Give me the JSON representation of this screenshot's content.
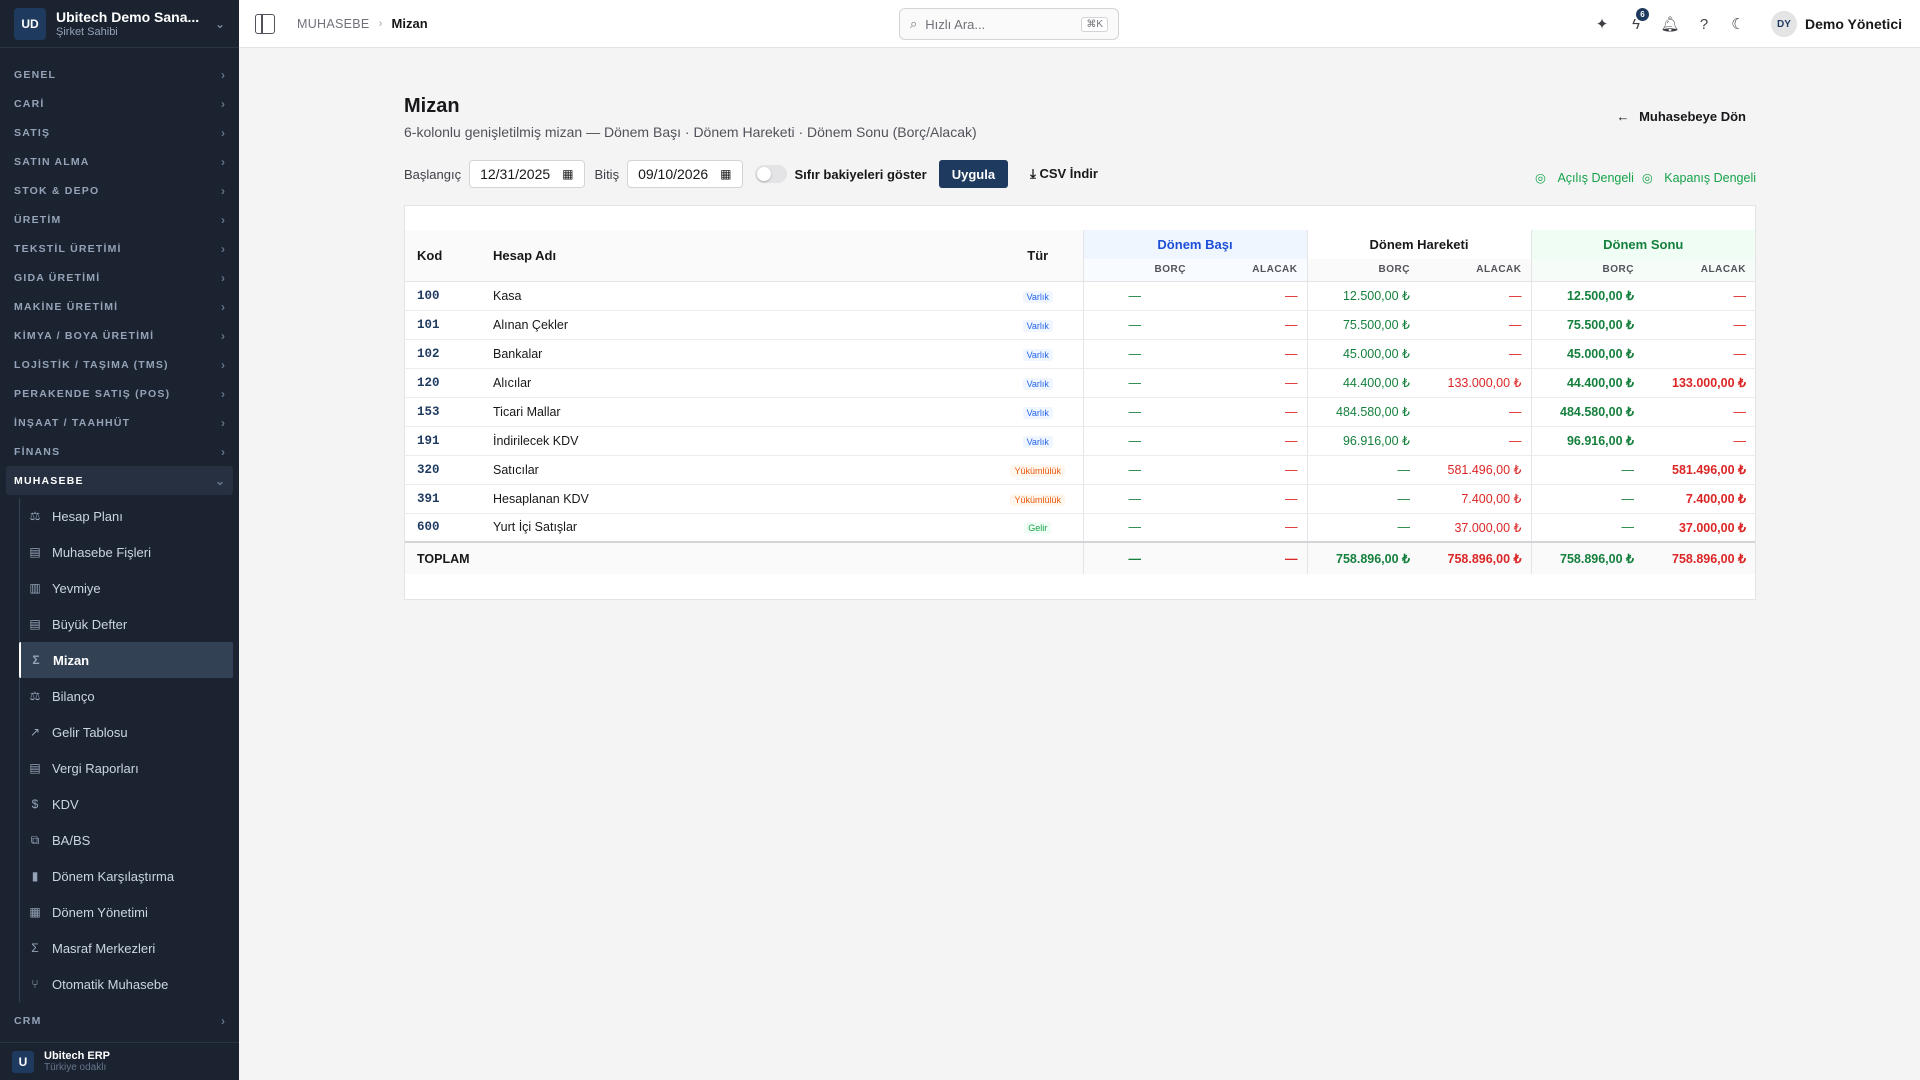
{
  "company": {
    "initials": "UD",
    "name": "Ubitech Demo Sana...",
    "role": "Şirket Sahibi"
  },
  "nav_groups_top": [
    "GENEL",
    "CARİ",
    "SATIŞ",
    "SATIN ALMA",
    "STOK & DEPO",
    "ÜRETİM",
    "TEKSTİL ÜRETİMİ",
    "GIDA ÜRETİMİ",
    "MAKİNE ÜRETİMİ",
    "KİMYA / BOYA ÜRETİMİ",
    "LOJİSTİK / TAŞIMA (TMS)",
    "PERAKENDE SATIŞ (POS)",
    "İNŞAAT / TAAHHÜT",
    "FİNANS"
  ],
  "open_group": "MUHASEBE",
  "sub_items": [
    {
      "label": "Hesap Planı",
      "icon": "scale-icon"
    },
    {
      "label": "Muhasebe Fişleri",
      "icon": "file-icon"
    },
    {
      "label": "Yevmiye",
      "icon": "clipboard-icon"
    },
    {
      "label": "Büyük Defter",
      "icon": "file-icon"
    },
    {
      "label": "Mizan",
      "icon": "sigma-icon",
      "active": true
    },
    {
      "label": "Bilanço",
      "icon": "scale-icon"
    },
    {
      "label": "Gelir Tablosu",
      "icon": "trend-up-icon"
    },
    {
      "label": "Vergi Raporları",
      "icon": "file-icon"
    },
    {
      "label": "KDV",
      "icon": "file-dollar-icon"
    },
    {
      "label": "BA/BS",
      "icon": "copy-icon"
    },
    {
      "label": "Dönem Karşılaştırma",
      "icon": "bar-chart-icon"
    },
    {
      "label": "Dönem Yönetimi",
      "icon": "calendar-icon"
    },
    {
      "label": "Masraf Merkezleri",
      "icon": "sigma-icon"
    },
    {
      "label": "Otomatik Muhasebe",
      "icon": "git-branch-icon"
    }
  ],
  "nav_group_bottom": "CRM",
  "footer": {
    "initial": "U",
    "title": "Ubitech ERP",
    "subtitle": "Türkiye odaklı"
  },
  "topbar": {
    "breadcrumb_parent": "MUHASEBE",
    "breadcrumb_current": "Mizan",
    "search_placeholder": "Hızlı Ara...",
    "search_shortcut": "⌘K",
    "notif_count": "6",
    "user_initials": "DY",
    "user_name": "Demo Yönetici"
  },
  "page": {
    "title": "Mizan",
    "subtitle": "6-kolonlu genişletilmiş mizan — Dönem Başı · Dönem Hareketi · Dönem Sonu (Borç/Alacak)",
    "back_label": "Muhasebeye Dön",
    "start_label": "Başlangıç",
    "start_date": "12/31/2025",
    "end_label": "Bitiş",
    "end_date": "09/10/2026",
    "zero_toggle_label": "Sıfır bakiyeleri göster",
    "apply_label": "Uygula",
    "csv_label": "CSV İndir",
    "opening_balanced": "Açılış Dengeli",
    "closing_balanced": "Kapanış Dengeli"
  },
  "table": {
    "headers": {
      "kod": "Kod",
      "ad": "Hesap Adı",
      "tur": "Tür",
      "donem_basi": "Dönem Başı",
      "donem_hareketi": "Dönem Hareketi",
      "donem_sonu": "Dönem Sonu",
      "borc": "BORÇ",
      "alacak": "ALACAK"
    },
    "rows": [
      {
        "kod": "100",
        "ad": "Kasa",
        "tur": "Varlık",
        "tur_class": "varlik",
        "bb": "—",
        "ba": "—",
        "hb": "12.500,00 ₺",
        "ha": "—",
        "sb": "12.500,00 ₺",
        "sa": "—"
      },
      {
        "kod": "101",
        "ad": "Alınan Çekler",
        "tur": "Varlık",
        "tur_class": "varlik",
        "bb": "—",
        "ba": "—",
        "hb": "75.500,00 ₺",
        "ha": "—",
        "sb": "75.500,00 ₺",
        "sa": "—"
      },
      {
        "kod": "102",
        "ad": "Bankalar",
        "tur": "Varlık",
        "tur_class": "varlik",
        "bb": "—",
        "ba": "—",
        "hb": "45.000,00 ₺",
        "ha": "—",
        "sb": "45.000,00 ₺",
        "sa": "—"
      },
      {
        "kod": "120",
        "ad": "Alıcılar",
        "tur": "Varlık",
        "tur_class": "varlik",
        "bb": "—",
        "ba": "—",
        "hb": "44.400,00 ₺",
        "ha": "133.000,00 ₺",
        "sb": "44.400,00 ₺",
        "sa": "133.000,00 ₺"
      },
      {
        "kod": "153",
        "ad": "Ticari Mallar",
        "tur": "Varlık",
        "tur_class": "varlik",
        "bb": "—",
        "ba": "—",
        "hb": "484.580,00 ₺",
        "ha": "—",
        "sb": "484.580,00 ₺",
        "sa": "—"
      },
      {
        "kod": "191",
        "ad": "İndirilecek KDV",
        "tur": "Varlık",
        "tur_class": "varlik",
        "bb": "—",
        "ba": "—",
        "hb": "96.916,00 ₺",
        "ha": "—",
        "sb": "96.916,00 ₺",
        "sa": "—"
      },
      {
        "kod": "320",
        "ad": "Satıcılar",
        "tur": "Yükümlülük",
        "tur_class": "yuk",
        "bb": "—",
        "ba": "—",
        "hb": "—",
        "ha": "581.496,00 ₺",
        "sb": "—",
        "sa": "581.496,00 ₺"
      },
      {
        "kod": "391",
        "ad": "Hesaplanan KDV",
        "tur": "Yükümlülük",
        "tur_class": "yuk",
        "bb": "—",
        "ba": "—",
        "hb": "—",
        "ha": "7.400,00 ₺",
        "sb": "—",
        "sa": "7.400,00 ₺"
      },
      {
        "kod": "600",
        "ad": "Yurt İçi Satışlar",
        "tur": "Gelir",
        "tur_class": "gelir",
        "bb": "—",
        "ba": "—",
        "hb": "—",
        "ha": "37.000,00 ₺",
        "sb": "—",
        "sa": "37.000,00 ₺"
      }
    ],
    "total": {
      "label": "TOPLAM",
      "bb": "—",
      "ba": "—",
      "hb": "758.896,00 ₺",
      "ha": "758.896,00 ₺",
      "sb": "758.896,00 ₺",
      "sa": "758.896,00 ₺"
    }
  },
  "colors": {
    "brand": "#1e3a5f",
    "debit": "#15803d",
    "credit": "#dc2626",
    "sidebar": "#1c2330"
  }
}
